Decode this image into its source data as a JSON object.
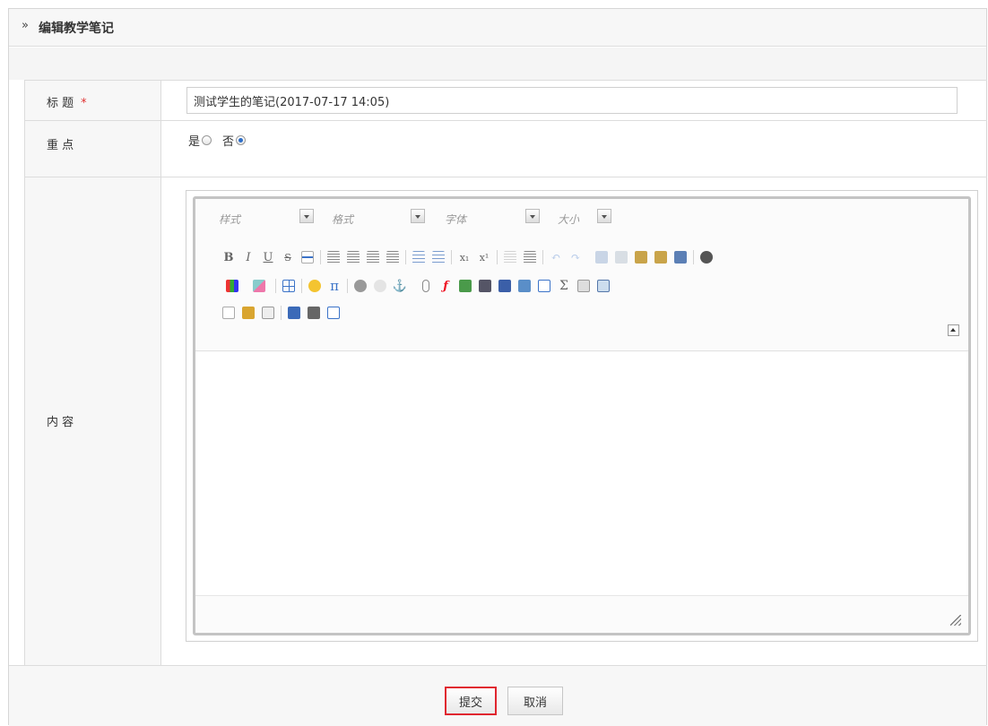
{
  "header": {
    "chevron": "»",
    "title": "编辑教学笔记"
  },
  "form": {
    "title_label": "标 题",
    "required_mark": "*",
    "title_value": "测试学生的笔记(2017-07-17 14:05)",
    "key_label": "重 点",
    "key_options": [
      {
        "label": "是",
        "checked": false
      },
      {
        "label": "否",
        "checked": true
      }
    ],
    "content_label": "内 容"
  },
  "editor": {
    "combos": [
      "样式",
      "格式",
      "字体",
      "大小"
    ],
    "format_buttons": [
      "B",
      "I",
      "U",
      "S"
    ],
    "subscript": "x₁",
    "superscript": "x¹",
    "pi": "π",
    "sigma": "Σ",
    "content": ""
  },
  "footer": {
    "submit_label": "提交",
    "cancel_label": "取消"
  },
  "colors": {
    "submit_highlight": "#e0262f",
    "border": "#dcdcdc",
    "label_bg": "#f7f7f7"
  }
}
